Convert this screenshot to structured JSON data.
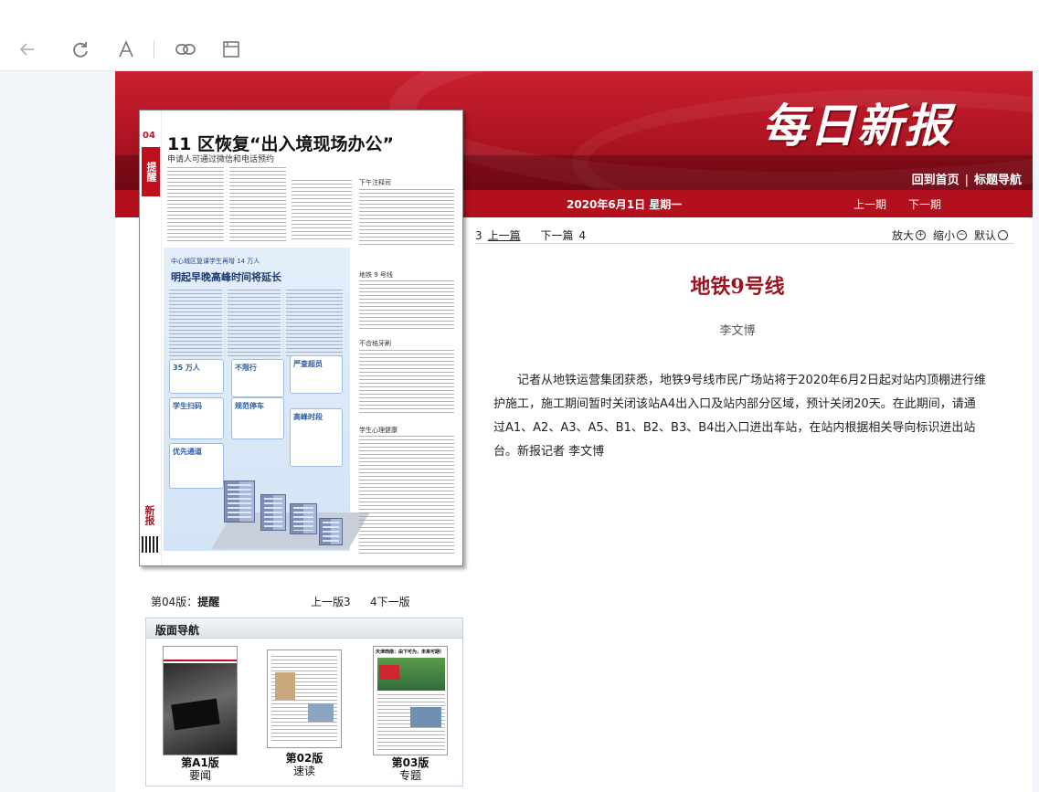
{
  "browser": {
    "icons": [
      "back-arrow-icon",
      "reload-icon",
      "font-icon",
      "link-icon",
      "window-icon"
    ]
  },
  "masthead": {
    "logo": "每日新报",
    "home_link": "回到首页",
    "title_nav_link": "标题导航",
    "separator": "|",
    "date": "2020年6月1日 星期一",
    "prev_issue": "上一期",
    "next_issue": "下一期",
    "colors": {
      "brand_red": "#b3101e",
      "title_red": "#9c1422"
    }
  },
  "newspaper_page": {
    "page_number": "04",
    "section_tag": "提醒",
    "headline": "11 区恢复“出入境现场办公”",
    "subhead": "申请人可通过微信和电话预约",
    "infographic_kicker": "中心城区复课学生再增 14 万人",
    "infographic_title": "明起早晚高峰时间将延长",
    "cards": [
      "35 万人",
      "学生扫码",
      "优先通道",
      "不限行",
      "规范停车",
      "严查超员",
      "高峰时段"
    ],
    "right_column_heads": [
      "下午注释司",
      "地铁 9 号线",
      "不合格牙刷",
      "学生心理健康"
    ],
    "vertical_brand": "新报"
  },
  "article": {
    "nav": {
      "prev_num": "3",
      "prev_label": "上一篇",
      "next_label": "下一篇",
      "next_num": "4"
    },
    "zoom": {
      "zoom_in": "放大",
      "zoom_out": "缩小",
      "reset": "默认"
    },
    "title": "地铁9号线",
    "author": "李文博",
    "body": "记者从地铁运营集团获悉，地铁9号线市民广场站将于2020年6月2日起对站内顶棚进行维护施工，施工期间暂时关闭该站A4出入口及站内部分区域，预计关闭20天。在此期间，请通过A1、A2、A3、A5、B1、B2、B3、B4出入口进出车站，在站内根据相关导向标识进出站台。新报记者 李文博"
  },
  "page_nav": {
    "current_label": "第04版：",
    "current_section": "提醒",
    "prev": "上一版3",
    "next": "4下一版"
  },
  "layout_nav": {
    "header": "版面导航",
    "pages": [
      {
        "num": "第A1版",
        "section": "要闻"
      },
      {
        "num": "第02版",
        "section": "速读"
      },
      {
        "num": "第03版",
        "section": "专题"
      }
    ],
    "thumb3_headline": "天津西南：由下可为，未来可期!"
  }
}
